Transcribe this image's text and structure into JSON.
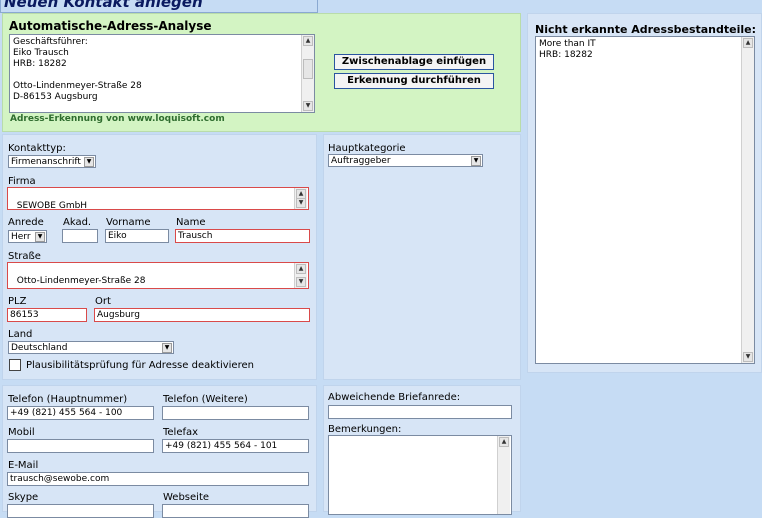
{
  "page": {
    "title": "Neuen Kontakt anlegen"
  },
  "analysis": {
    "heading": "Automatische-Adress-Analyse",
    "text": "Geschäftsführer:\nEiko Trausch\nHRB: 18282\n\nOtto-Lindenmeyer-Straße 28\nD-86153 Augsburg",
    "paste_button": "Zwischenablage einfügen",
    "run_button": "Erkennung durchführen",
    "credit": "Adress-Erkennung von www.loquisoft.com"
  },
  "unrecognized": {
    "heading": "Nicht erkannte Adressbestandteile:",
    "text": "More than IT\nHRB: 18282"
  },
  "address": {
    "kontakttyp_label": "Kontakttyp:",
    "kontakttyp_value": "Firmenanschrift",
    "firma_label": "Firma",
    "firma_value": "SEWOBE GmbH",
    "anrede_label": "Anrede",
    "anrede_value": "Herr",
    "akad_label": "Akad.",
    "akad_value": "",
    "vorname_label": "Vorname",
    "vorname_value": "Eiko",
    "name_label": "Name",
    "name_value": "Trausch",
    "strasse_label": "Straße",
    "strasse_value": "Otto-Lindenmeyer-Straße 28",
    "plz_label": "PLZ",
    "plz_value": "86153",
    "ort_label": "Ort",
    "ort_value": "Augsburg",
    "land_label": "Land",
    "land_value": "Deutschland",
    "plausi_label": "Plausibilitätsprüfung für Adresse deaktivieren"
  },
  "category": {
    "label": "Hauptkategorie",
    "value": "Auftraggeber"
  },
  "contact": {
    "tel_main_label": "Telefon (Hauptnummer)",
    "tel_main_value": "+49 (821) 455 564 - 100",
    "tel_more_label": "Telefon (Weitere)",
    "tel_more_value": "",
    "mobil_label": "Mobil",
    "mobil_value": "",
    "fax_label": "Telefax",
    "fax_value": "+49 (821) 455 564 - 101",
    "email_label": "E-Mail",
    "email_value": "trausch@sewobe.com",
    "skype_label": "Skype",
    "web_label": "Webseite"
  },
  "extra": {
    "briefanrede_label": "Abweichende Briefanrede:",
    "briefanrede_value": "",
    "bemerkungen_label": "Bemerkungen:",
    "bemerkungen_value": ""
  }
}
